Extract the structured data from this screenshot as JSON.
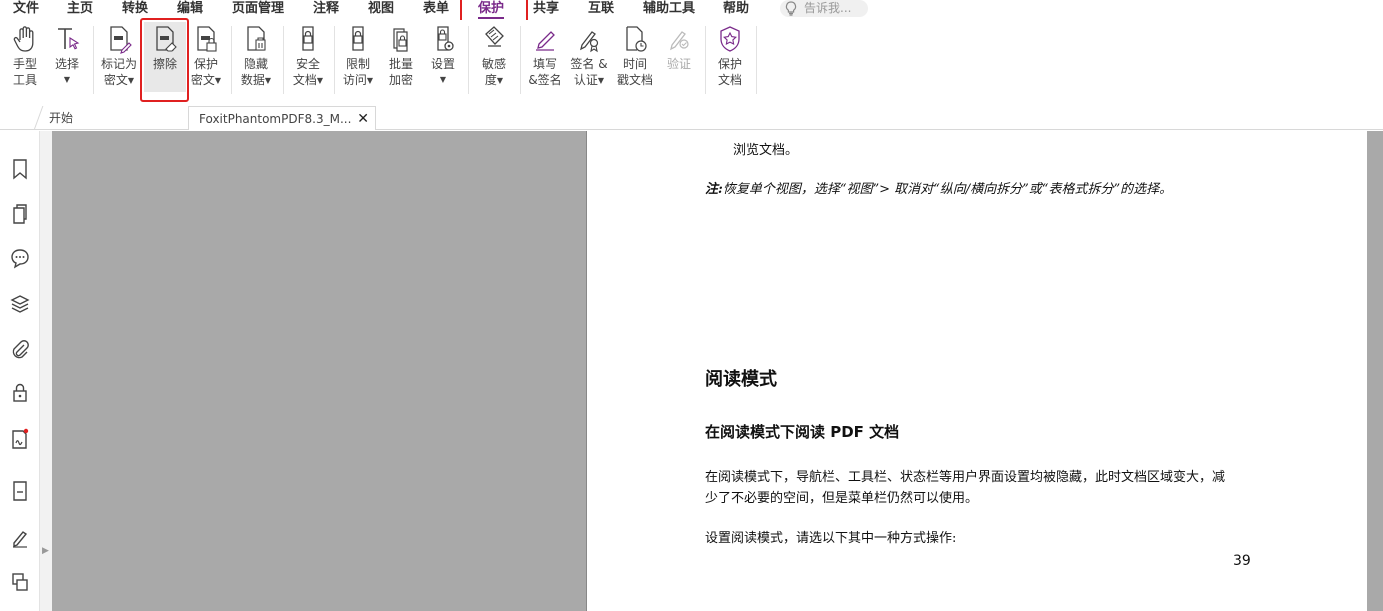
{
  "menu": {
    "items": [
      "文件",
      "主页",
      "转换",
      "编辑",
      "页面管理",
      "注释",
      "视图",
      "表单",
      "保护",
      "共享",
      "互联",
      "辅助工具",
      "帮助"
    ],
    "active": "保护",
    "tell_me_placeholder": "告诉我..."
  },
  "ribbon": {
    "hand": [
      "手型",
      "工具"
    ],
    "select": "选择",
    "mark_redact": [
      "标记为",
      "密文"
    ],
    "erase": "擦除",
    "apply_redact": [
      "保护",
      "密文"
    ],
    "hide_data": [
      "隐藏",
      "数据"
    ],
    "secure_doc": [
      "安全",
      "文档"
    ],
    "restrict": [
      "限制",
      "访问"
    ],
    "batch": [
      "批量",
      "加密"
    ],
    "settings": "设置",
    "sensitivity": [
      "敏感",
      "度"
    ],
    "fill_sign": [
      "填写",
      "&签名"
    ],
    "sign_cert": [
      "签名 &",
      "认证"
    ],
    "timestamp": [
      "时间",
      "戳文档"
    ],
    "validate": "验证",
    "protect_doc": [
      "保护",
      "文档"
    ]
  },
  "tabs": {
    "start": "开始",
    "doc": "FoxitPhantomPDF8.3_M..."
  },
  "page": {
    "line1": "浏览文档。",
    "note_label": "注:",
    "note_text": "恢复单个视图，选择“视图”> 取消对“纵向/横向拆分”或“表格式拆分”的选择。",
    "heading1": "阅读模式",
    "heading2": "在阅读模式下阅读 PDF 文档",
    "para1a": "在阅读模式下，导航栏、工具栏、状态栏等用户界面设置均被隐藏，此时文档区域变大，减",
    "para1b": "少了不必要的空间，但是菜单栏仍然可以使用。",
    "para2": "设置阅读模式，请选以下其中一种方式操作:",
    "page_number": "39"
  },
  "colors": {
    "accent": "#7a2a8a",
    "highlight": "#e02020",
    "canvas": "#a9a9a9"
  }
}
